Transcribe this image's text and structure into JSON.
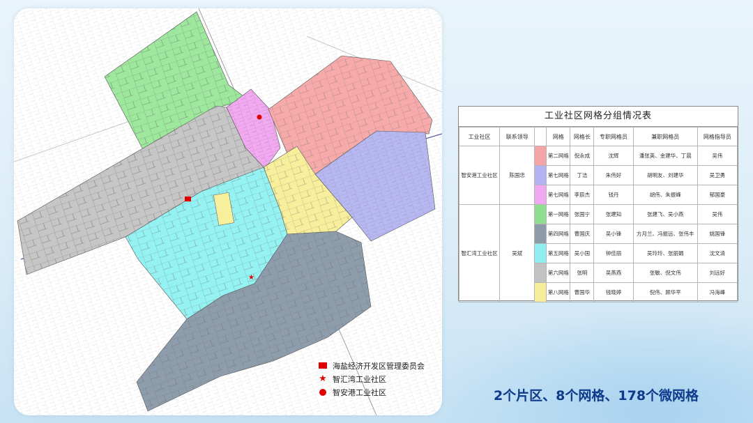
{
  "legend": [
    {
      "icon": "flag-icon",
      "label": "海盐经济开发区管理委员会"
    },
    {
      "icon": "star-icon",
      "label": "智汇湾工业社区"
    },
    {
      "icon": "dot-icon",
      "label": "智安港工业社区"
    }
  ],
  "table": {
    "title": "工业社区网格分组情况表",
    "headers": [
      "工业社区",
      "联系领导",
      "",
      "网格",
      "网格长",
      "专职网格员",
      "兼职网格员",
      "网格指导员"
    ],
    "groups": [
      {
        "community": "智安港工业社区",
        "leader": "陈国忠",
        "rows": [
          {
            "color": "#f4a6a6",
            "grid": "第二网格",
            "head": "倪永成",
            "full": "沈辉",
            "part": "潘张英、金建华、丁晨",
            "guide": "吴伟"
          },
          {
            "color": "#b3b3f2",
            "grid": "第七网格",
            "head": "丁洁",
            "full": "朱伟好",
            "part": "胡明友、刘建华",
            "guide": "吴卫勇"
          },
          {
            "color": "#f0a8f0",
            "grid": "第七网格",
            "head": "李辰杰",
            "full": "钱丹",
            "part": "胡伟、朱振峰",
            "guide": "郁国豪"
          }
        ]
      },
      {
        "community": "智汇湾工业社区",
        "leader": "吴斌",
        "rows": [
          {
            "color": "#8ee08e",
            "grid": "第一网格",
            "head": "张国宁",
            "full": "张建知",
            "part": "张建飞、吴小燕",
            "guide": "吴伟"
          },
          {
            "color": "#8c9ba8",
            "grid": "第四网格",
            "head": "曹国庆",
            "full": "吴小锋",
            "part": "方月兰、冯振远、张伟丰",
            "guide": "姚国锋"
          },
          {
            "color": "#8ef0f0",
            "grid": "第五网格",
            "head": "吴小国",
            "full": "钟佳丽",
            "part": "吴玲玲、张丽娟",
            "guide": "沈文清"
          },
          {
            "color": "#c2c2c2",
            "grid": "第六网格",
            "head": "张明",
            "full": "吴燕燕",
            "part": "张敏、倪文伟",
            "guide": "刘远好"
          },
          {
            "color": "#f7ee9a",
            "grid": "第八网格",
            "head": "曹国华",
            "full": "钱晓婷",
            "part": "倪伟、顾华平",
            "guide": "冯海峰"
          }
        ]
      }
    ]
  },
  "caption": "2个片区、8个网格、178个微网格"
}
